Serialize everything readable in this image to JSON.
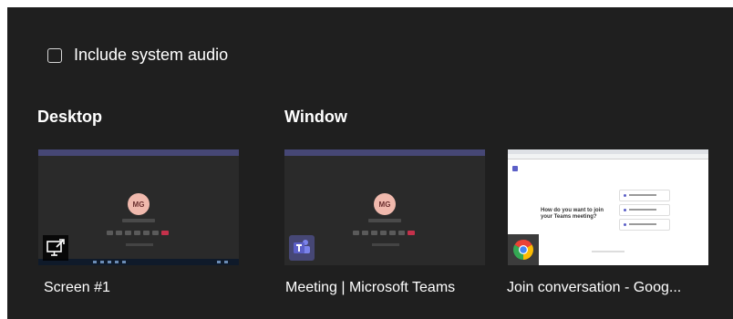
{
  "options": {
    "include_system_audio": {
      "label": "Include system audio",
      "checked": false
    }
  },
  "sections": {
    "desktop": {
      "title": "Desktop",
      "items": [
        {
          "caption": "Screen #1",
          "icon": "screen-share-icon",
          "preview_initials": "MG"
        }
      ]
    },
    "window": {
      "title": "Window",
      "items": [
        {
          "caption": "Meeting | Microsoft Teams",
          "icon": "teams-logo-icon",
          "preview_initials": "MG"
        },
        {
          "caption": "Join conversation - Goog...",
          "icon": "chrome-logo-icon",
          "preview_heading": "How do you want to join your Teams meeting?"
        }
      ]
    }
  },
  "colors": {
    "panel_background": "#1f1f1f",
    "teams_purple": "#464775",
    "avatar": "#f0b9ad",
    "end_call_red": "#c4314b"
  }
}
